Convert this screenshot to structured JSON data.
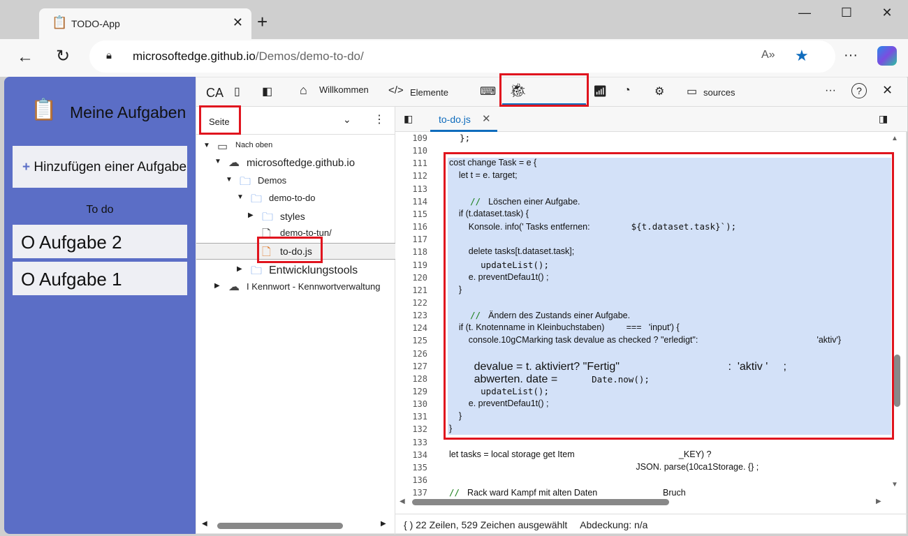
{
  "browser": {
    "tab_title": "TODO-App",
    "url_host": "microsoftedge.github.io",
    "url_path": "/Demos/demo-to-do/"
  },
  "app": {
    "title": "Meine Aufgaben",
    "add_button": "Hinzufügen einer Aufgabe",
    "section": "To do",
    "tasks": [
      "O Aufgabe 2",
      "O Aufgabe 1"
    ]
  },
  "devtools": {
    "tabs": {
      "ca": "CA",
      "welcome": "Willkommen",
      "elements": "Elemente",
      "sources": "sources"
    },
    "nav": {
      "tab": "Seite",
      "tree": [
        {
          "label": "Nach oben",
          "icon": "frame-icon",
          "level": 0,
          "arrow": "down"
        },
        {
          "label": "microsoftedge.github.io",
          "icon": "cloud-icon",
          "level": 1,
          "arrow": "down"
        },
        {
          "label": "Demos",
          "icon": "folder-icon",
          "level": 2,
          "arrow": "down"
        },
        {
          "label": "demo-to-do",
          "icon": "folder-icon",
          "level": 3,
          "arrow": "down"
        },
        {
          "label": "styles",
          "icon": "folder-icon",
          "level": 4,
          "arrow": "right"
        },
        {
          "label": "demo-to-tun/",
          "icon": "file-icon",
          "level": 4,
          "arrow": ""
        },
        {
          "label": "to-do.js",
          "icon": "js-file-icon",
          "level": 4,
          "arrow": "",
          "selected": true
        },
        {
          "label": "Entwicklungstools",
          "icon": "folder-icon",
          "level": 3,
          "arrow": "right"
        },
        {
          "label": "I Kennwort - Kennwortverwaltung",
          "icon": "cloud-icon",
          "level": 1,
          "arrow": "right"
        }
      ]
    },
    "editor": {
      "file_tab": "to-do.js",
      "lines": [
        {
          "n": "109",
          "parts": [
            [
              "  };",
              "m"
            ]
          ]
        },
        {
          "n": "110",
          "parts": []
        },
        {
          "n": "111",
          "parts": [
            [
              "cost change Task = e {",
              ""
            ]
          ]
        },
        {
          "n": "112",
          "parts": [
            [
              "    let t = e. target;",
              ""
            ]
          ]
        },
        {
          "n": "113",
          "parts": []
        },
        {
          "n": "114",
          "parts": [
            [
              "    // ",
              "c"
            ],
            [
              " Löschen einer Aufgabe.",
              ""
            ]
          ]
        },
        {
          "n": "115",
          "parts": [
            [
              "    if (t.dataset.task) {",
              ""
            ]
          ]
        },
        {
          "n": "116",
          "parts": [
            [
              "        Konsole. info(' Tasks entfernen:                 ",
              ""
            ],
            [
              "${t.dataset.task}`);",
              "m"
            ]
          ]
        },
        {
          "n": "117",
          "parts": []
        },
        {
          "n": "118",
          "parts": [
            [
              "        delete tasks[t.dataset.task];",
              ""
            ]
          ]
        },
        {
          "n": "119",
          "parts": [
            [
              "      updateList();",
              "m"
            ]
          ]
        },
        {
          "n": "120",
          "parts": [
            [
              "        e. preventDefau1t() ;",
              ""
            ]
          ]
        },
        {
          "n": "121",
          "parts": [
            [
              "    }",
              ""
            ]
          ]
        },
        {
          "n": "122",
          "parts": []
        },
        {
          "n": "123",
          "parts": [
            [
              "    // ",
              "c"
            ],
            [
              " Ändern des Zustands einer Aufgabe.",
              ""
            ]
          ]
        },
        {
          "n": "124",
          "parts": [
            [
              "    if (t. Knotenname in Kleinbuchstaben)         ===   'input') {",
              ""
            ]
          ]
        },
        {
          "n": "125",
          "parts": [
            [
              "        console.10gCMarking task devalue as checked ? \"erledigt\":                                                 'aktiv'}",
              ""
            ]
          ]
        },
        {
          "n": "126",
          "parts": []
        },
        {
          "n": "127",
          "parts": [
            [
              "        devalue = t. aktiviert? \"Fertig\"                                   :  'aktiv '     ;",
              "big"
            ]
          ]
        },
        {
          "n": "128",
          "parts": [
            [
              "        abwerten. date =           ",
              "big"
            ],
            [
              "Date.now();",
              "m"
            ]
          ]
        },
        {
          "n": "129",
          "parts": [
            [
              "      updateList();",
              "m"
            ]
          ]
        },
        {
          "n": "130",
          "parts": [
            [
              "        e. preventDefau1t() ;",
              ""
            ]
          ]
        },
        {
          "n": "131",
          "parts": [
            [
              "    }",
              ""
            ]
          ]
        },
        {
          "n": "132",
          "parts": [
            [
              "}",
              ""
            ]
          ]
        },
        {
          "n": "133",
          "parts": []
        },
        {
          "n": "134",
          "parts": [
            [
              "let tasks = local storage get Item                                           _KEY) ?",
              ""
            ]
          ]
        },
        {
          "n": "135",
          "parts": [
            [
              "                                                                             JSON. parse(10ca1Storage. {} ;",
              ""
            ]
          ]
        },
        {
          "n": "136",
          "parts": []
        },
        {
          "n": "137",
          "parts": [
            [
              "// ",
              "c"
            ],
            [
              " Rack ward Kampf mit alten Daten                           Bruch",
              ""
            ]
          ]
        }
      ],
      "status": "22 Zeilen, 529 Zeichen ausgewählt",
      "coverage": "Abdeckung: n/a",
      "status_icon": "{ )"
    }
  },
  "colors": {
    "app_bg": "#5b6ec6",
    "selection": "#d3e1f8",
    "highlight": "#e0141e",
    "accent": "#0f6cbd"
  }
}
